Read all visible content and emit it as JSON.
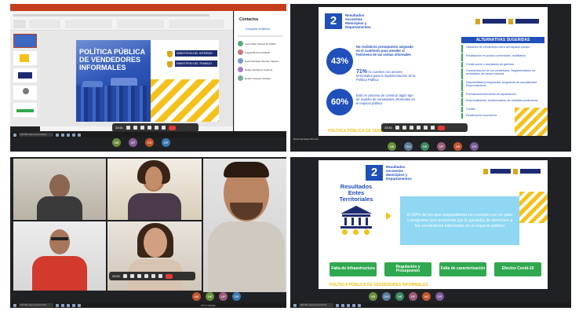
{
  "q1": {
    "slide_title_line1": "POLÍTICA PÚBLICA",
    "slide_title_line2": "DE VENDEDORES",
    "slide_title_line3": "INFORMALES",
    "ministry1": "MINISTERIO DEL INTERIOR",
    "ministry2": "MINISTERIO DEL TRABAJO",
    "contacts_title": "Contactos",
    "share_label": "Compartir invitación",
    "contacts": [
      "Juan Pablo Pacurdi Ri. PRIM...",
      "Angela Becerra Ardilado",
      "David Santiago Montoto Viguero",
      "Nataly Rodríguez Carlema",
      "Nelson Vazquez Rodgila"
    ],
    "search_text": "Escribe aquí para buscar"
  },
  "q2": {
    "number": "2",
    "header_line1": "Resultados",
    "header_line2": "encuestas",
    "header_line3": "Municipios y",
    "header_line4": "Departamentos",
    "pct1": "43%",
    "pct2": "60%",
    "text1": "No recibieron presupuesto asignado en el cuatrienio para atender al fenómeno de las ventas informales",
    "text2_head": "71%",
    "text2": "no cuentan con actores territoriales para la implementación de la Política Pública",
    "text3": "Está en proceso de construir algún tipo de registro de vendedores informales en el espacio público",
    "alt_title": "ALTERNATIVAS SUGERIDAS",
    "alternatives": [
      "Ubicación de vendedores fuera del espacio público",
      "Reubicación en puntos comerciales, mobiliarios",
      "Construcción o ampliación de galerías",
      "Caracterización de los vendedores, Reglamentación de actividades del sector informal",
      "Disponibilidad presupuestal, programas de asociatividad Emprendedores",
      "Formalizaciones/cursos de capacitación",
      "Emprendimiento, fortalecimiento de unidades productivas",
      "Crédito",
      "Reactivación económica"
    ],
    "footer": "POLÍTICA PÚBLICA DE VENDEDORES INFORMALES",
    "presenter": "David Santiago Montoto",
    "time": "33:51"
  },
  "q3": {
    "time": "33:51",
    "search_text": "Escribe aquí para buscar",
    "weather": "19°C Nublado"
  },
  "q4": {
    "number": "2",
    "header_line1": "Resultados",
    "header_line2": "encuestas",
    "header_line3": "Municipios y",
    "header_line4": "Departamentos",
    "entes_line1": "Resultados",
    "entes_line2": "Entes",
    "entes_line3": "Territoriales",
    "statement": "El 60% de los que respondieron no cuentan con un plan o programa que propenda por la garantía de derechos a los vendedores informales en el espacio público",
    "cards": [
      "Falta de Infraestructura",
      "Regulación y Presupuesto",
      "Falta de caracterización",
      "Efectos Covid-19"
    ],
    "footer": "POLÍTICA PÚBLICA DE VENDEDORES INFORMALES",
    "search_text": "Escribe aquí para buscar"
  },
  "colors": {
    "navy": "#1d2b70",
    "blue": "#1f4fb8",
    "yellow": "#f5c21b",
    "green": "#2fa84f",
    "teal": "#1aa59a"
  }
}
